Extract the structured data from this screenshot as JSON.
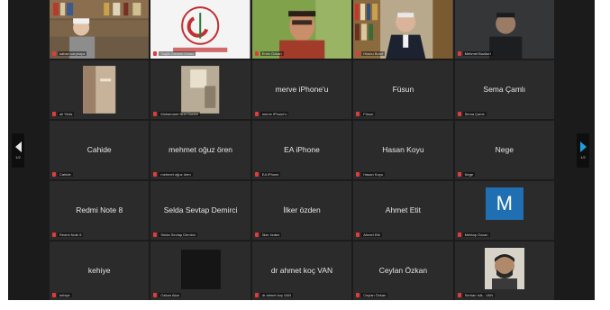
{
  "meeting": {
    "nav_prev": {
      "page": "1/2"
    },
    "nav_next": {
      "page": "1/2"
    },
    "rows": [
      [
        {
          "type": "video",
          "scene": "bookshelf-man",
          "label": "sahan sarpkaya"
        },
        {
          "type": "logo",
          "scene": "logo",
          "label": "Saglik Meslek Odasi"
        },
        {
          "type": "video",
          "scene": "man-green",
          "label": "Emin Ozkan"
        },
        {
          "type": "video",
          "scene": "man-suit",
          "label": "Husnu Bulut"
        },
        {
          "type": "video",
          "scene": "dark-man",
          "label": "Mehmet Bozkurt"
        }
      ],
      [
        {
          "type": "video",
          "scene": "wall-lamp",
          "label": "ali Yildiz"
        },
        {
          "type": "video",
          "scene": "wall-light",
          "label": "Muhammet Nuri Gunes"
        },
        {
          "type": "name",
          "name": "merve iPhone'u",
          "label": "merve iPhone'u"
        },
        {
          "type": "name",
          "name": "Füsun",
          "label": "Füsun"
        },
        {
          "type": "name",
          "name": "Sema Çamlı",
          "label": "Sema Çamlı"
        }
      ],
      [
        {
          "type": "name",
          "name": "Cahide",
          "label": "Cahide"
        },
        {
          "type": "name",
          "name": "mehmet oğuz ören",
          "label": "mehmet oğuz ören"
        },
        {
          "type": "name",
          "name": "EA iPhone",
          "label": "EA iPhone"
        },
        {
          "type": "name",
          "name": "Hasan Koyu",
          "label": "Hasan Koyu"
        },
        {
          "type": "name",
          "name": "Nege",
          "label": "Nege"
        }
      ],
      [
        {
          "type": "name",
          "name": "Redmi Note 8",
          "label": "Redmi Note 8"
        },
        {
          "type": "name",
          "name": "Selda Sevtap Demirci",
          "label": "Selda Sevtap Demirci"
        },
        {
          "type": "name",
          "name": "İlker özden",
          "label": "İlker özden"
        },
        {
          "type": "name",
          "name": "Ahmet Etit",
          "label": "Ahmet Etit"
        },
        {
          "type": "avatar",
          "letter": "M",
          "label": "Mehtap Ozcan"
        }
      ],
      [
        {
          "type": "name",
          "name": "kehiye",
          "label": "kehiye"
        },
        {
          "type": "blackpic",
          "label": "Ozkan Akar"
        },
        {
          "type": "name",
          "name": "dr ahmet koç VAN",
          "label": "dr ahmet koç VAN"
        },
        {
          "type": "name",
          "name": "Ceylan Özkan",
          "label": "Ceylan Özkan"
        },
        {
          "type": "photo",
          "label": "Serhan Isik - VAN"
        }
      ]
    ]
  },
  "colors": {
    "stage": "#1b1b1b",
    "tile": "#2b2b2b",
    "mic_muted": "#e23b3b",
    "avatar_blue": "#1f6fb2",
    "nav_arrow": "#1ea0e0"
  }
}
